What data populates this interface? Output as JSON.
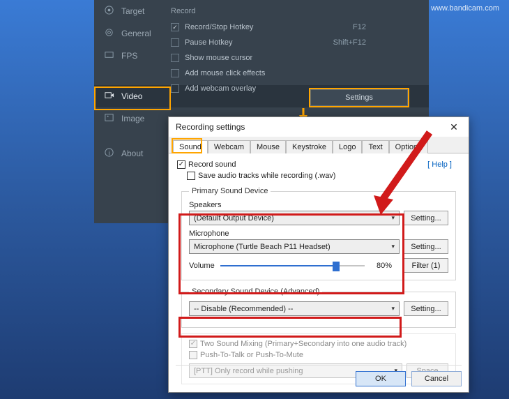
{
  "watermark": "www.bandicam.com",
  "sidebar": {
    "items": [
      {
        "icon": "target-icon",
        "label": "Target"
      },
      {
        "icon": "gear-icon",
        "label": "General"
      },
      {
        "icon": "fps-icon",
        "label": "FPS"
      },
      {
        "icon": "video-icon",
        "label": "Video"
      },
      {
        "icon": "image-icon",
        "label": "Image"
      },
      {
        "icon": "info-icon",
        "label": "About"
      }
    ],
    "selected_index": 3
  },
  "app": {
    "section": "Record",
    "rows": [
      {
        "label": "Record/Stop Hotkey",
        "checked": true,
        "value": "F12"
      },
      {
        "label": "Pause Hotkey",
        "checked": false,
        "value": "Shift+F12"
      },
      {
        "label": "Show mouse cursor",
        "checked": false,
        "value": ""
      },
      {
        "label": "Add mouse click effects",
        "checked": false,
        "value": ""
      },
      {
        "label": "Add webcam overlay",
        "checked": false,
        "value": ""
      }
    ],
    "settings_button": "Settings"
  },
  "dialog": {
    "title": "Recording settings",
    "tabs": [
      "Sound",
      "Webcam",
      "Mouse",
      "Keystroke",
      "Logo",
      "Text",
      "Options"
    ],
    "active_tab": 0,
    "help": "[ Help ]",
    "record_sound": {
      "label": "Record sound",
      "checked": true
    },
    "save_wav": {
      "label": "Save audio tracks while recording (.wav)",
      "checked": false
    },
    "primary": {
      "legend": "Primary Sound Device",
      "speakers_label": "Speakers",
      "speakers_value": "(Default Output Device)",
      "speakers_btn": "Setting...",
      "mic_label": "Microphone",
      "mic_value": "Microphone (Turtle Beach P11 Headset)",
      "mic_btn": "Setting...",
      "volume_label": "Volume",
      "volume_pct": "80%",
      "filter_btn": "Filter (1)"
    },
    "secondary": {
      "legend": "Secondary Sound Device (Advanced)",
      "value": "-- Disable (Recommended) --",
      "btn": "Setting..."
    },
    "advanced": {
      "two_mixing": {
        "label": "Two Sound Mixing (Primary+Secondary into one audio track)",
        "checked": true,
        "disabled": true
      },
      "ptt": {
        "label": "Push-To-Talk or Push-To-Mute",
        "checked": false,
        "disabled": true
      },
      "ptt_mode": "[PTT] Only record while pushing",
      "ptt_key": "Space"
    },
    "ok": "OK",
    "cancel": "Cancel"
  }
}
